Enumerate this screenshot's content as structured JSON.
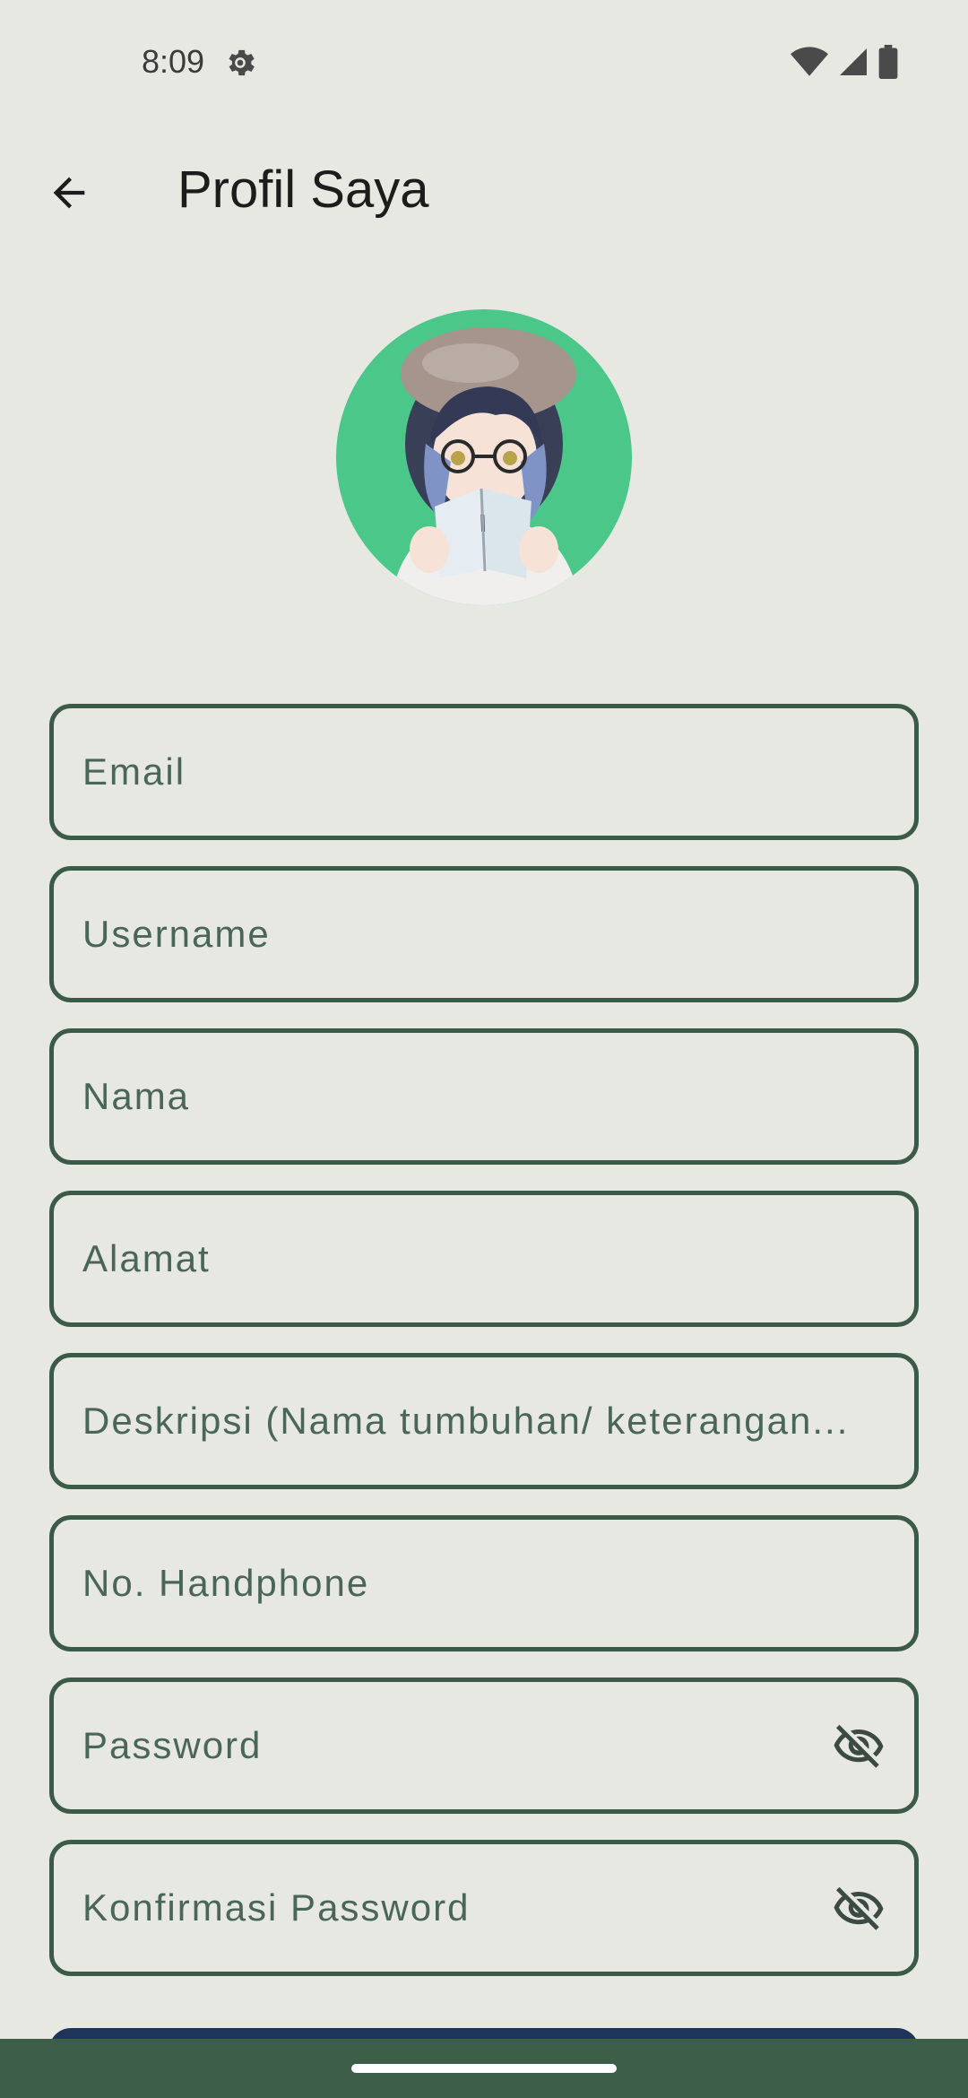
{
  "status": {
    "time": "8:09"
  },
  "app_bar": {
    "title": "Profil Saya"
  },
  "colors": {
    "avatar_bg": "#4bc78a",
    "field_border": "#3b5a47",
    "nav_bar": "#3d5e48",
    "button": "#1f3459"
  },
  "form": {
    "email": {
      "placeholder": "Email"
    },
    "username": {
      "placeholder": "Username"
    },
    "nama": {
      "placeholder": "Nama"
    },
    "alamat": {
      "placeholder": "Alamat"
    },
    "deskripsi": {
      "placeholder": "Deskripsi (Nama tumbuhan/ keterangan..."
    },
    "phone": {
      "placeholder": "No. Handphone"
    },
    "password": {
      "placeholder": "Password"
    },
    "confirm_password": {
      "placeholder": "Konfirmasi Password"
    }
  }
}
